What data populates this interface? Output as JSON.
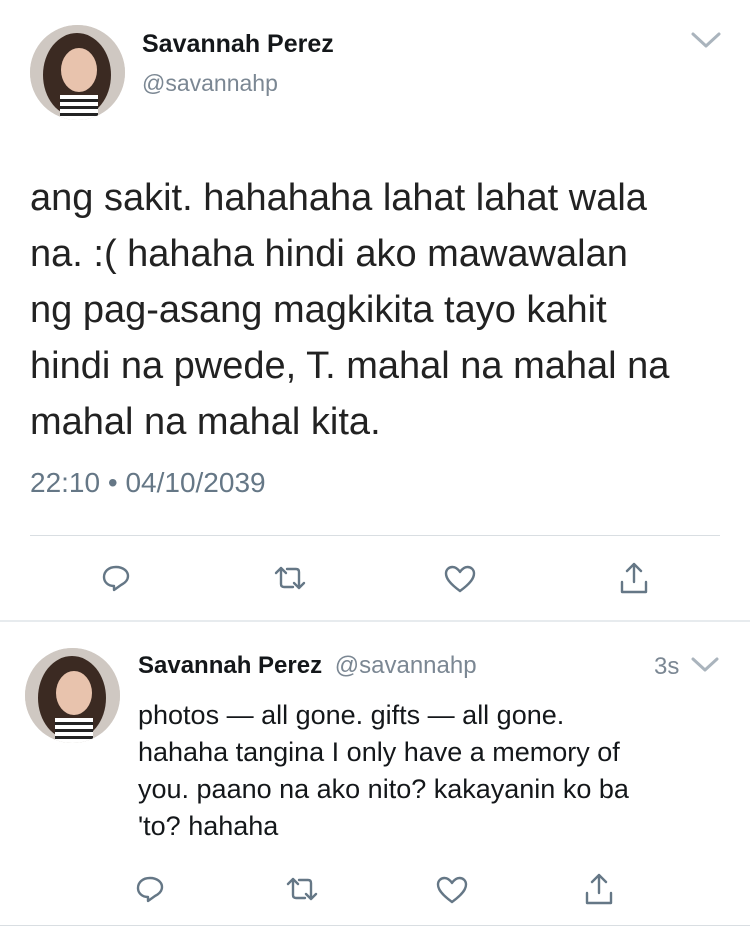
{
  "main_tweet": {
    "author_name": "Savannah Perez",
    "handle": "@savannahp",
    "text_lines": [
      "ang sakit. hahahaha lahat lahat wala",
      "na. :( hahaha hindi ako mawawalan",
      "ng pag-asang magkikita tayo kahit",
      "hindi na pwede, T. mahal na mahal na",
      "mahal na mahal kita."
    ],
    "time": "22:10",
    "separator": "•",
    "date": "04/10/2039"
  },
  "reply": {
    "author_name": "Savannah Perez",
    "handle": "@savannahp",
    "age": "3s",
    "text_lines": [
      "photos — all gone. gifts — all gone.",
      "hahaha tangina I only have a memory of",
      "you. paano na ako nito? kakayanin ko ba",
      "'to? hahaha"
    ]
  },
  "icons": {
    "reply": "reply-icon",
    "retweet": "retweet-icon",
    "like": "heart-icon",
    "share": "share-icon",
    "menu": "chevron-down-icon"
  },
  "colors": {
    "text": "#14171a",
    "muted": "#7b8793",
    "icon": "#657786"
  }
}
